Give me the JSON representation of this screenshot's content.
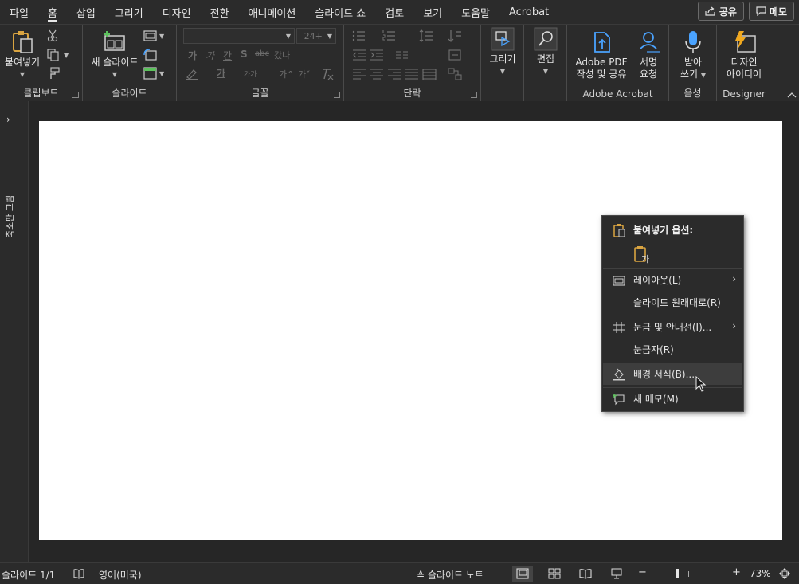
{
  "menu": {
    "tabs": [
      {
        "label": "파일"
      },
      {
        "label": "홈"
      },
      {
        "label": "삽입"
      },
      {
        "label": "그리기"
      },
      {
        "label": "디자인"
      },
      {
        "label": "전환"
      },
      {
        "label": "애니메이션"
      },
      {
        "label": "슬라이드 쇼"
      },
      {
        "label": "검토"
      },
      {
        "label": "보기"
      },
      {
        "label": "도움말"
      },
      {
        "label": "Acrobat"
      }
    ],
    "active_tab": "홈",
    "share_label": "공유",
    "comment_label": "메모"
  },
  "ribbon": {
    "clipboard": {
      "paste_label": "붙여넣기",
      "group_label": "클립보드"
    },
    "slides": {
      "new_slide_label": "새 슬라이드",
      "group_label": "슬라이드"
    },
    "font": {
      "group_label": "글꼴",
      "size_placeholder": "24+",
      "bold_glyph": "가",
      "italic_glyph": "가",
      "underline_glyph": "간",
      "shadow_glyph": "S",
      "strike_glyph": "abc",
      "spacing_glyph": "갔나",
      "color_glyph": "가",
      "case_glyph": "가가",
      "grow_glyph": "가^",
      "shrink_glyph": "가ˇ"
    },
    "paragraph": {
      "group_label": "단락"
    },
    "drawing": {
      "label": "그리기"
    },
    "editing": {
      "label": "편집"
    },
    "acrobat": {
      "pdf_label_1": "Adobe PDF",
      "pdf_label_2": "작성 및 공유",
      "sign_label_1": "서명",
      "sign_label_2": "요청",
      "group_label": "Adobe Acrobat"
    },
    "voice": {
      "dictate_label_1": "받아",
      "dictate_label_2": "쓰기",
      "group_label": "음성"
    },
    "designer": {
      "ideas_label_1": "디자인",
      "ideas_label_2": "아이디어",
      "group_label": "Designer"
    }
  },
  "sidebar": {
    "vertical_label": "축소판 그림"
  },
  "context_menu": {
    "paste_options_label": "붙여넣기 옵션:",
    "items": [
      {
        "label": "레이아웃(L)",
        "submenu": true
      },
      {
        "label": "슬라이드 원래대로(R)",
        "submenu": false
      },
      {
        "label": "눈금 및 안내선(I)...",
        "submenu": true
      },
      {
        "label": "눈금자(R)",
        "submenu": false
      },
      {
        "label": "배경 서식(B)...",
        "submenu": false,
        "highlighted": true
      },
      {
        "label": "새 메모(M)",
        "submenu": false
      }
    ]
  },
  "status": {
    "slide_counter": "슬라이드 1/1",
    "language": "영어(미국)",
    "notes_label": "슬라이드 노트",
    "zoom_minus": "−",
    "zoom_plus": "+",
    "zoom_level": "73%"
  },
  "colors": {
    "accent_blue": "#4aa3ff",
    "clipboard_gold": "#d9a441",
    "menu_bg": "#2b2b2b",
    "slide_bg": "#ffffff"
  }
}
